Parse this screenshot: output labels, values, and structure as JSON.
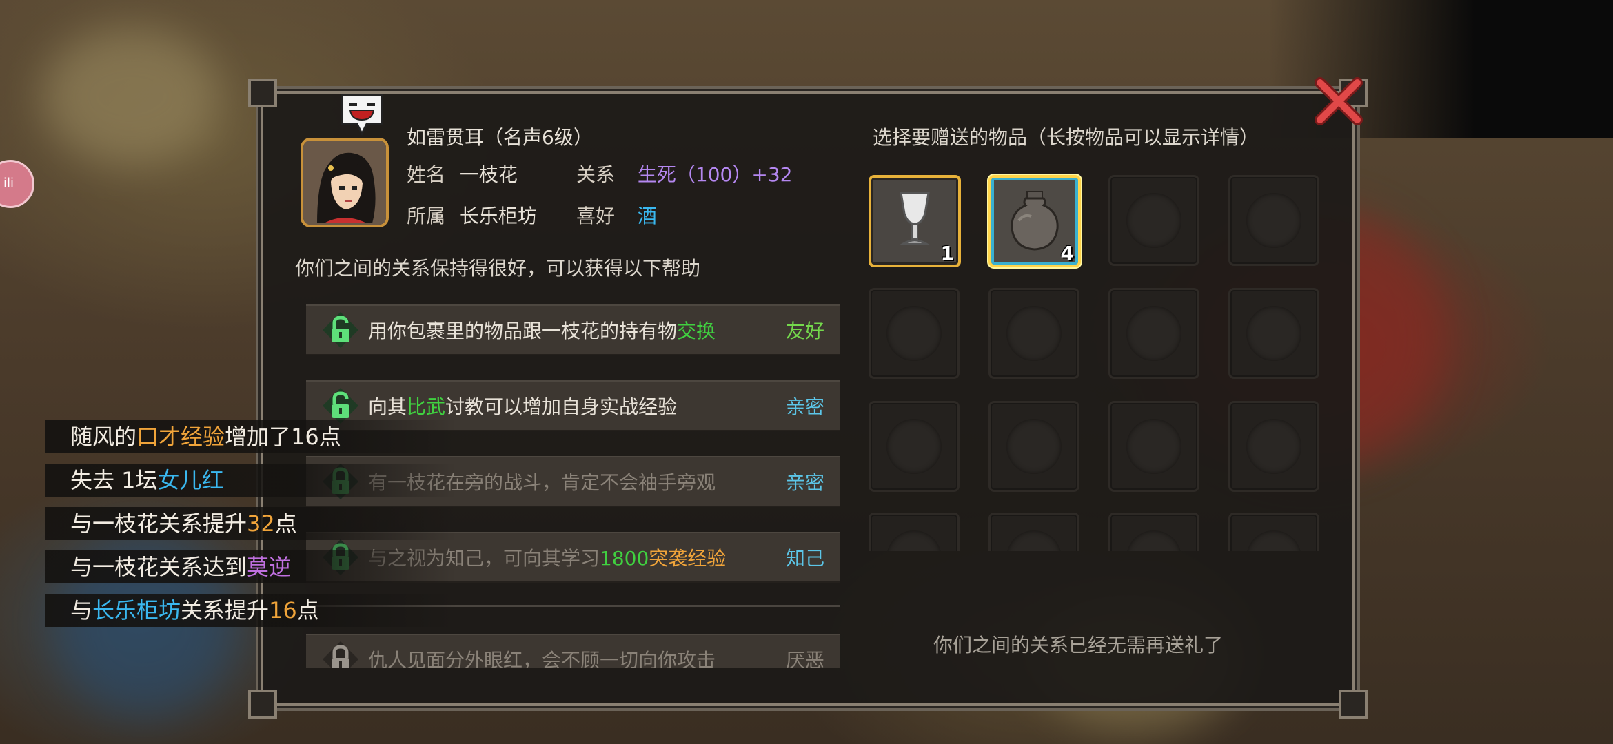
{
  "npc": {
    "title": "如雷贯耳（名声6级）",
    "name_label": "姓名",
    "name": "一枝花",
    "relation_label": "关系",
    "relation": "生死（100）+32",
    "faction_label": "所属",
    "faction": "长乐柜坊",
    "likes_label": "喜好",
    "likes": "酒"
  },
  "help": {
    "intro": "你们之间的关系保持得很好，可以获得以下帮助",
    "rows": [
      {
        "pre": "用你包裹里的物品跟一枝花的持有物",
        "hl": "交换",
        "post": "",
        "tier": "友好"
      },
      {
        "pre": "向其",
        "hl": "比武",
        "post": "讨教可以增加自身实战经验",
        "tier": "亲密"
      },
      {
        "pre": "有一枝花在旁的战斗，肯定不会袖手旁观",
        "hl": "",
        "post": "",
        "tier": "亲密"
      },
      {
        "pre": "与之视为知己，可向其学习",
        "hl": "1800",
        "post": "突袭经验",
        "tier": "知己"
      },
      {
        "pre": "",
        "hl": "",
        "post": "",
        "tier": ""
      },
      {
        "pre": "仇人见面分外眼红，会不顾一切向你攻击",
        "hl": "",
        "post": "",
        "tier": "厌恶"
      }
    ]
  },
  "gift": {
    "title": "选择要赠送的物品（长按物品可以显示详情）",
    "items": [
      {
        "name": "goblet",
        "qty": "1"
      },
      {
        "name": "wine-jar",
        "qty": "4"
      }
    ],
    "message": "你们之间的关系已经无需再送礼了"
  },
  "notices": [
    {
      "parts": [
        "随风的",
        "口才经验",
        "增加了16点"
      ]
    },
    {
      "parts": [
        "失去 1坛",
        "女儿红",
        ""
      ]
    },
    {
      "parts": [
        "与一枝花关系提升",
        "32",
        "点"
      ]
    },
    {
      "parts": [
        "与一枝花关系达到",
        "莫逆",
        ""
      ]
    },
    {
      "parts": [
        "与",
        "长乐柜坊",
        "关系提升",
        "16",
        "点"
      ]
    }
  ],
  "colors": {
    "relation": "#b487f0",
    "tier": "#5cc6e8",
    "highlight_green": "#40d040",
    "item_border": "#e8b23a"
  },
  "icons": [
    "close-icon",
    "speech-bubble-icon",
    "unlock-icon",
    "lock-icon",
    "goblet-icon",
    "wine-jar-icon"
  ]
}
